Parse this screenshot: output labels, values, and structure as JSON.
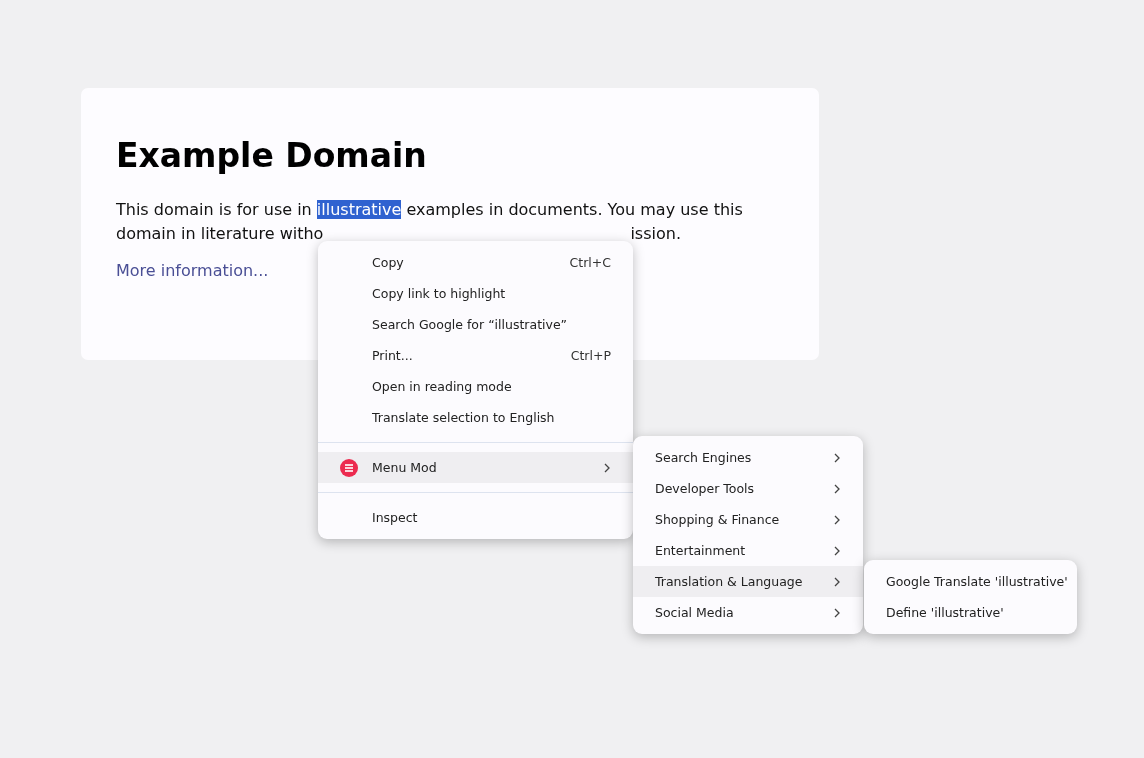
{
  "page": {
    "heading": "Example Domain",
    "paragraph_line_1": [
      {
        "text": "This domain is for use in ",
        "selected": false
      },
      {
        "text": "illustrative",
        "selected": true
      },
      {
        "text": " examples in documents. You may use this",
        "selected": false
      }
    ],
    "paragraph_line_2": [
      "domain in literature witho",
      "ission."
    ],
    "link": "More information..."
  },
  "context_menu": {
    "items": [
      {
        "kind": "item",
        "label": "Copy",
        "shortcut": "Ctrl+C",
        "selected": false
      },
      {
        "kind": "item",
        "label": "Copy link to highlight",
        "selected": false
      },
      {
        "kind": "item",
        "label": "Search Google for “illustrative”",
        "selected": false
      },
      {
        "kind": "item",
        "label": "Print...",
        "shortcut": "Ctrl+P",
        "selected": false
      },
      {
        "kind": "item",
        "label": "Open in reading mode",
        "selected": false
      },
      {
        "kind": "item",
        "label": "Translate selection to English",
        "selected": false
      },
      {
        "kind": "separator"
      },
      {
        "kind": "submenu",
        "label": "Menu Mod",
        "selected": true
      },
      {
        "kind": "separator"
      },
      {
        "kind": "item",
        "label": "Inspect",
        "selected": false
      }
    ]
  },
  "submenu": {
    "items": [
      {
        "kind": "submenu",
        "label": "Search Engines",
        "selected": false
      },
      {
        "kind": "submenu",
        "label": "Developer Tools",
        "selected": false
      },
      {
        "kind": "submenu",
        "label": "Shopping & Finance",
        "selected": false
      },
      {
        "kind": "submenu",
        "label": "Entertainment",
        "selected": false
      },
      {
        "kind": "submenu",
        "label": "Translation & Language",
        "selected": true
      },
      {
        "kind": "submenu",
        "label": "Social Media",
        "selected": false
      }
    ]
  },
  "nested_submenu": {
    "items": [
      {
        "kind": "item",
        "label": "Google Translate 'illustrative'",
        "selected": false
      },
      {
        "kind": "item",
        "label": "Define 'illustrative'",
        "selected": false
      }
    ]
  }
}
